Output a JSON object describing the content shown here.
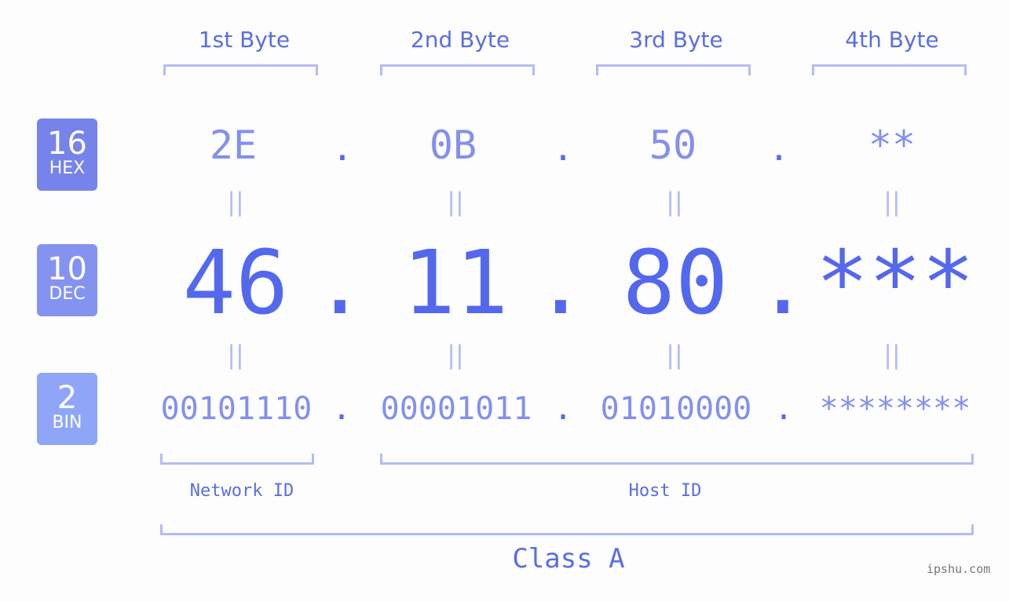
{
  "bytes": [
    {
      "header": "1st Byte",
      "hex": "2E",
      "dec": "46",
      "bin": "00101110"
    },
    {
      "header": "2nd Byte",
      "hex": "0B",
      "dec": "11",
      "bin": "00001011"
    },
    {
      "header": "3rd Byte",
      "hex": "50",
      "dec": "80",
      "bin": "01010000"
    },
    {
      "header": "4th Byte",
      "hex": "**",
      "dec": "***",
      "bin": "********"
    }
  ],
  "separator": ".",
  "equals": "=",
  "badges": {
    "hex": {
      "num": "16",
      "label": "HEX",
      "color": "#7683ea"
    },
    "dec": {
      "num": "10",
      "label": "DEC",
      "color": "#8593f0"
    },
    "bin": {
      "num": "2",
      "label": "BIN",
      "color": "#8fa6f8"
    }
  },
  "labels": {
    "network": "Network ID",
    "host": "Host ID",
    "class": "Class A"
  },
  "watermark": "ipshu.com"
}
